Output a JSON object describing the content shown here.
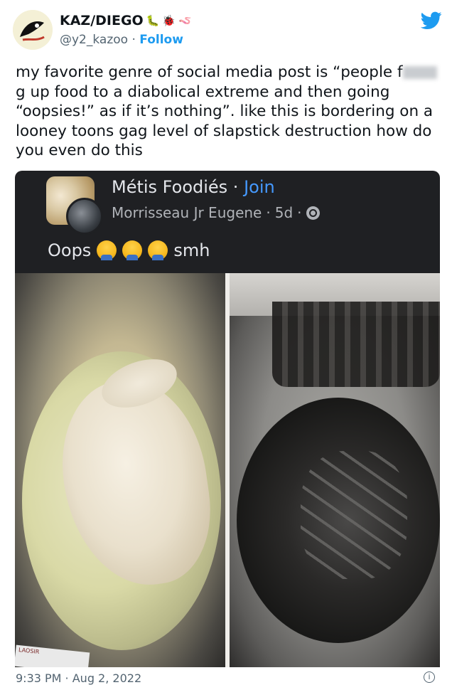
{
  "tweet": {
    "display_name": "KAZ/DIEGO",
    "name_emojis": [
      "🐛",
      "🐞",
      "🪱"
    ],
    "handle": "@y2_kazoo",
    "separator": " · ",
    "follow_label": "Follow",
    "text_part1": "my favorite genre of social media post is “people f",
    "text_part2": "g up food to a diabolical extreme and then going “oopsies!” as if it’s nothing”. like this is bordering on a looney toons gag level of slapstick destruction how do you even do this",
    "timestamp": "9:33 PM · Aug 2, 2022",
    "brand_color": "#1d9bf0"
  },
  "embedded_post": {
    "group_name": "Métis Foodiés",
    "join_label": "Join",
    "join_separator": " · ",
    "author": "Morrisseau Jr Eugene",
    "age": "5d",
    "meta_separator": "·",
    "body_text_before": "Oops",
    "body_emojis": [
      "facepalm",
      "facepalm",
      "facepalm"
    ],
    "body_text_after": "smh",
    "photo_label": "LAOSIR"
  },
  "colors": {
    "card_background": "#1f2023",
    "join_link": "#4599ff"
  }
}
